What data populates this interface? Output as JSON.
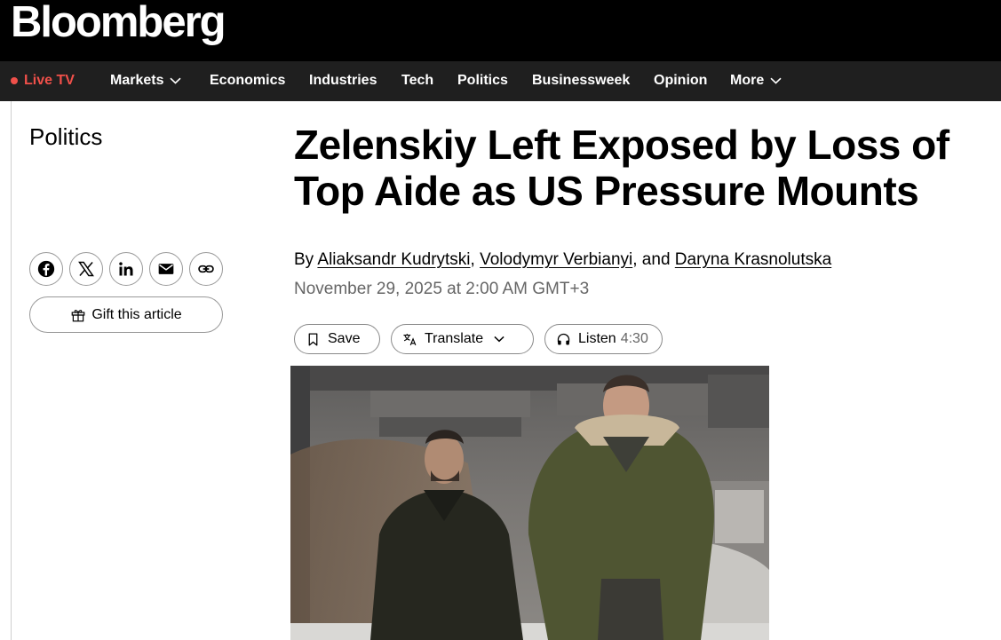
{
  "brand": {
    "logo_text": "Bloomberg"
  },
  "nav": {
    "live_label": "Live TV",
    "items": [
      {
        "label": "Markets",
        "has_dropdown": true
      },
      {
        "label": "Economics",
        "has_dropdown": false
      },
      {
        "label": "Industries",
        "has_dropdown": false
      },
      {
        "label": "Tech",
        "has_dropdown": false
      },
      {
        "label": "Politics",
        "has_dropdown": false
      },
      {
        "label": "Businessweek",
        "has_dropdown": false
      },
      {
        "label": "Opinion",
        "has_dropdown": false
      },
      {
        "label": "More",
        "has_dropdown": true
      }
    ]
  },
  "article": {
    "section": "Politics",
    "headline_line1": "Zelenskiy Left Exposed by Loss of",
    "headline_line2": "Top Aide as US Pressure Mounts",
    "byline_prefix": "By ",
    "authors": [
      "Aliaksandr Kudrytski",
      "Volodymyr Verbianyi",
      "Daryna Krasnolutska"
    ],
    "sep1": ", ",
    "sep2": ", and ",
    "date": "November 29, 2025 at 2:00 AM GMT+3"
  },
  "share": {
    "icons": [
      "facebook-icon",
      "x-icon",
      "linkedin-icon",
      "email-icon",
      "link-icon"
    ],
    "gift_label": "Gift this article"
  },
  "actions": {
    "save_label": "Save",
    "translate_label": "Translate",
    "listen_label": "Listen",
    "listen_duration": "4:30"
  },
  "colors": {
    "masthead_bg": "#000000",
    "navbar_bg": "#1f1f1f",
    "live_accent": "#f0504a",
    "date_gray": "#666666"
  }
}
